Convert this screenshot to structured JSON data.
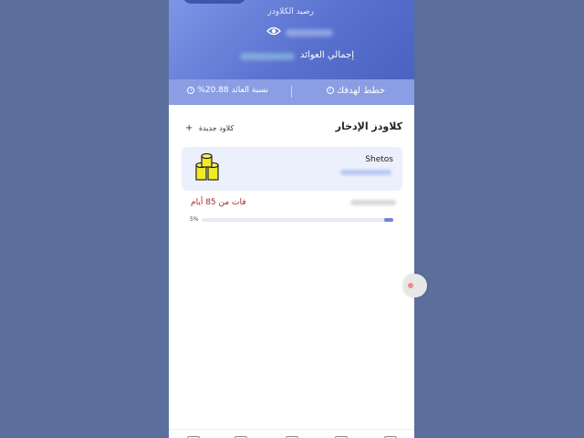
{
  "header": {
    "balance_label": "رصيد الكلاودز",
    "earnings_label": "إجمالي العوائد"
  },
  "stats": {
    "plan_label": "خطط لهدفك",
    "return_label": "نسبة العائد 20.88%"
  },
  "section": {
    "title": "كلاودز الإدخار",
    "new_label": "كلاود جديدة"
  },
  "card": {
    "name": "Shetos",
    "missed_text": "فات من 85 أيام",
    "progress_label": "5%",
    "progress_fraction": 0.05
  },
  "colors": {
    "accent": "#5a72cf",
    "statsbar": "#8c9ee3",
    "warning_text": "#a52a2a"
  }
}
